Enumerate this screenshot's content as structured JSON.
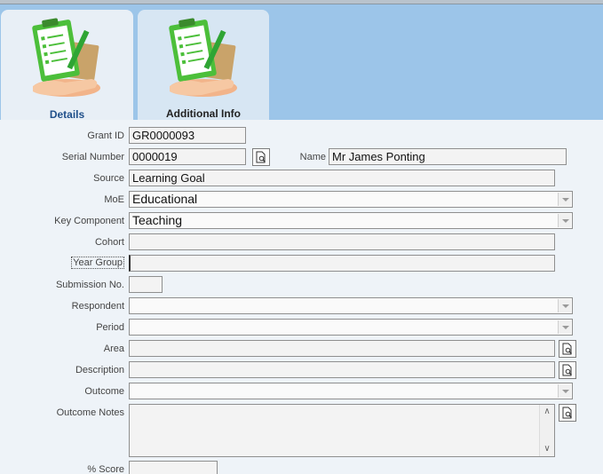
{
  "tabs": [
    {
      "label": "Details",
      "icon": "clipboard-hand-icon"
    },
    {
      "label": "Additional Info",
      "icon": "clipboard-hand-icon"
    }
  ],
  "form": {
    "grant_id": {
      "label": "Grant ID",
      "value": "GR0000093"
    },
    "serial_number": {
      "label": "Serial Number",
      "value": "0000019"
    },
    "name": {
      "label": "Name",
      "value": "Mr James Ponting"
    },
    "source": {
      "label": "Source",
      "value": "Learning Goal"
    },
    "moe": {
      "label": "MoE",
      "value": "Educational"
    },
    "key_component": {
      "label": "Key Component",
      "value": "Teaching"
    },
    "cohort": {
      "label": "Cohort",
      "value": ""
    },
    "year_group": {
      "label": "Year Group",
      "value": ""
    },
    "submission_no": {
      "label": "Submission No.",
      "value": ""
    },
    "respondent": {
      "label": "Respondent",
      "value": ""
    },
    "period": {
      "label": "Period",
      "value": ""
    },
    "area": {
      "label": "Area",
      "value": ""
    },
    "description": {
      "label": "Description",
      "value": ""
    },
    "outcome": {
      "label": "Outcome",
      "value": ""
    },
    "outcome_notes": {
      "label": "Outcome Notes",
      "value": ""
    },
    "score": {
      "label": "% Score",
      "value": ""
    }
  }
}
